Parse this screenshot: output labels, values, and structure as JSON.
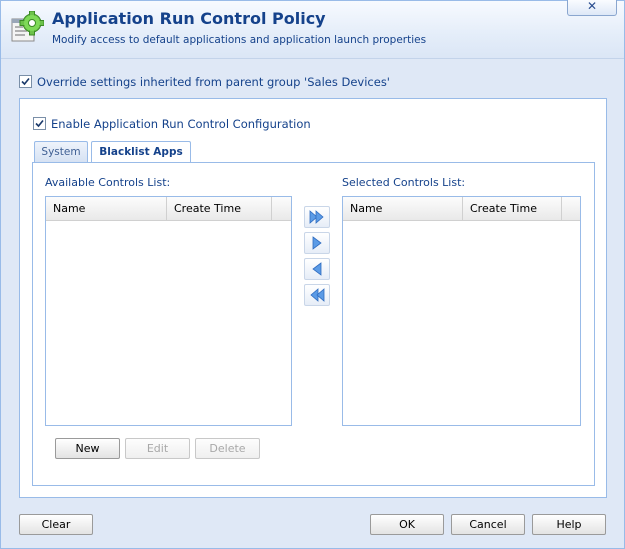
{
  "header": {
    "title": "Application Run Control Policy",
    "subtitle": "Modify access to default applications and application launch properties",
    "close_label": "✕",
    "icon": "gear-window-icon"
  },
  "override": {
    "label": "Override settings inherited from parent group 'Sales Devices'",
    "checked": true
  },
  "enable": {
    "label": "Enable Application Run Control Configuration",
    "checked": true
  },
  "tabs": [
    {
      "label": "System",
      "active": false
    },
    {
      "label": "Blacklist Apps",
      "active": true
    }
  ],
  "available": {
    "label": "Available Controls List:",
    "columns": [
      "Name",
      "Create Time"
    ],
    "rows": []
  },
  "selected": {
    "label": "Selected Controls List:",
    "columns": [
      "Name",
      "Create Time"
    ],
    "rows": []
  },
  "transfer": {
    "icons": [
      "move-all-right-icon",
      "move-right-icon",
      "move-left-icon",
      "move-all-left-icon"
    ]
  },
  "list_actions": {
    "new_label": "New",
    "edit_label": "Edit",
    "delete_label": "Delete"
  },
  "footer": {
    "clear_label": "Clear",
    "ok_label": "OK",
    "cancel_label": "Cancel",
    "help_label": "Help"
  },
  "colors": {
    "accent": "#15428b",
    "border": "#99bbe8",
    "arrow": "#3f7fd6"
  }
}
